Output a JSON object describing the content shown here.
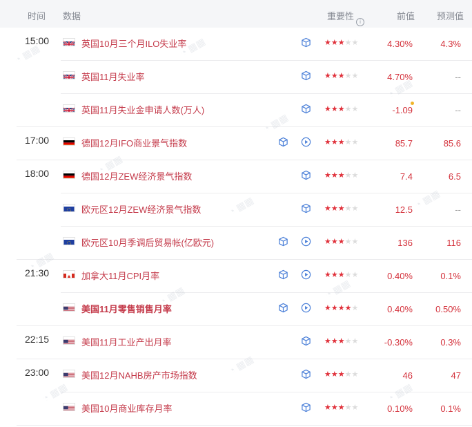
{
  "header": {
    "time": "时间",
    "data": "数据",
    "importance": "重要性",
    "previous": "前值",
    "forecast": "预测值"
  },
  "rows": [
    {
      "time": "15:00",
      "flag": "uk",
      "name": "英国10月三个月ILO失业率",
      "stars": 3,
      "prev": "4.30%",
      "forecast": "4.3%",
      "video": false,
      "bold": false,
      "sep_full": false
    },
    {
      "time": "",
      "flag": "uk",
      "name": "英国11月失业率",
      "stars": 3,
      "prev": "4.70%",
      "forecast": "--",
      "video": false,
      "bold": false,
      "sep_full": false
    },
    {
      "time": "",
      "flag": "uk",
      "name": "英国11月失业金申请人数(万人)",
      "stars": 3,
      "prev": "-1.09",
      "forecast": "--",
      "video": false,
      "bold": false,
      "sep_full": true
    },
    {
      "time": "17:00",
      "flag": "de",
      "name": "德国12月IFO商业景气指数",
      "stars": 3,
      "prev": "85.7",
      "forecast": "85.6",
      "video": true,
      "bold": false,
      "sep_full": true
    },
    {
      "time": "18:00",
      "flag": "de",
      "name": "德国12月ZEW经济景气指数",
      "stars": 3,
      "prev": "7.4",
      "forecast": "6.5",
      "video": false,
      "bold": false,
      "sep_full": false
    },
    {
      "time": "",
      "flag": "eu",
      "name": "欧元区12月ZEW经济景气指数",
      "stars": 3,
      "prev": "12.5",
      "forecast": "--",
      "video": false,
      "bold": false,
      "sep_full": false
    },
    {
      "time": "",
      "flag": "eu",
      "name": "欧元区10月季调后贸易帐(亿欧元)",
      "stars": 3,
      "prev": "136",
      "forecast": "116",
      "video": true,
      "bold": false,
      "sep_full": true
    },
    {
      "time": "21:30",
      "flag": "ca",
      "name": "加拿大11月CPI月率",
      "stars": 3,
      "prev": "0.40%",
      "forecast": "0.1%",
      "video": true,
      "bold": false,
      "sep_full": false
    },
    {
      "time": "",
      "flag": "us",
      "name": "美国11月零售销售月率",
      "stars": 4,
      "prev": "0.40%",
      "forecast": "0.50%",
      "video": true,
      "bold": true,
      "sep_full": true
    },
    {
      "time": "22:15",
      "flag": "us",
      "name": "美国11月工业产出月率",
      "stars": 3,
      "prev": "-0.30%",
      "forecast": "0.3%",
      "video": false,
      "bold": false,
      "sep_full": true
    },
    {
      "time": "23:00",
      "flag": "us",
      "name": "美国12月NAHB房产市场指数",
      "stars": 3,
      "prev": "46",
      "forecast": "47",
      "video": false,
      "bold": false,
      "sep_full": false
    },
    {
      "time": "",
      "flag": "us",
      "name": "美国10月商业库存月率",
      "stars": 3,
      "prev": "0.10%",
      "forecast": "0.1%",
      "video": false,
      "bold": false,
      "sep_full": true
    }
  ],
  "colors": {
    "accent": "#c43a4a",
    "star_on": "#e0313b",
    "star_off": "#dcdcdc",
    "icon_blue": "#4a7fd8",
    "header_bg": "#f5f6f8"
  },
  "icons": {
    "data_cube": "cube-icon",
    "video": "play-icon",
    "info": "info-icon"
  }
}
